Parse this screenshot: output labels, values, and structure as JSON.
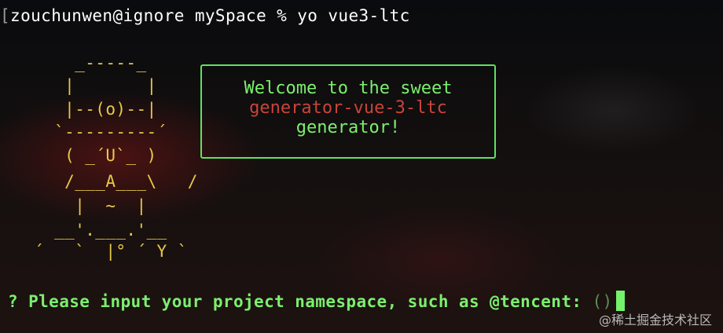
{
  "terminal": {
    "bracket": "[",
    "command": "zouchunwen@ignore mySpace % yo vue3-ltc"
  },
  "ascii_art": {
    "lines": [
      "     _-----_",
      "    |       |",
      "    |--(o)--|",
      "   `---------´",
      "    ( _´U`_ )",
      "    /___A___\\   /",
      "     |  ~  |",
      "   __'.___.'__",
      " ´   `  |° ´ Y `"
    ]
  },
  "welcome": {
    "line1": "Welcome to the sweet",
    "line2": "generator-vue-3-ltc",
    "line3": "generator!"
  },
  "prompt": {
    "question_mark": "?",
    "text": "Please input your project namespace, such as @tencent:",
    "hint": "()"
  },
  "watermark": "@稀土掘金技术社区",
  "colors": {
    "prompt_green": "#7cef6e",
    "generator_red": "#c9443a",
    "art_yellow": "#e7c94a",
    "box_border": "#5fe35f"
  }
}
